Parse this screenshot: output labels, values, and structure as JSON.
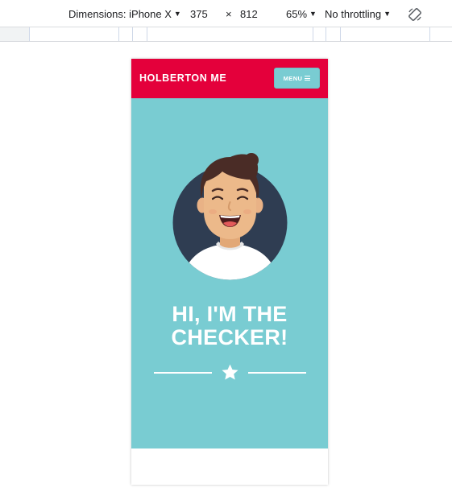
{
  "devtools": {
    "dimensions_label": "Dimensions: iPhone X",
    "width": "375",
    "times": "×",
    "height": "812",
    "zoom": "65%",
    "throttling": "No throttling",
    "caret": "▼",
    "rotate_icon": "rotate-icon"
  },
  "site": {
    "logo": "HOLBERTON ME",
    "menu_label": "MENU",
    "menu_icon": "hamburger-icon",
    "hero_title_line1": "HI, I'M THE",
    "hero_title_line2": "CHECKER!",
    "divider_icon": "star-icon",
    "colors": {
      "header": "#e4003b",
      "hero": "#79ccd2",
      "avatar_bg": "#2f3d52",
      "hair": "#4a2c26",
      "skin": "#ecb98a"
    }
  }
}
